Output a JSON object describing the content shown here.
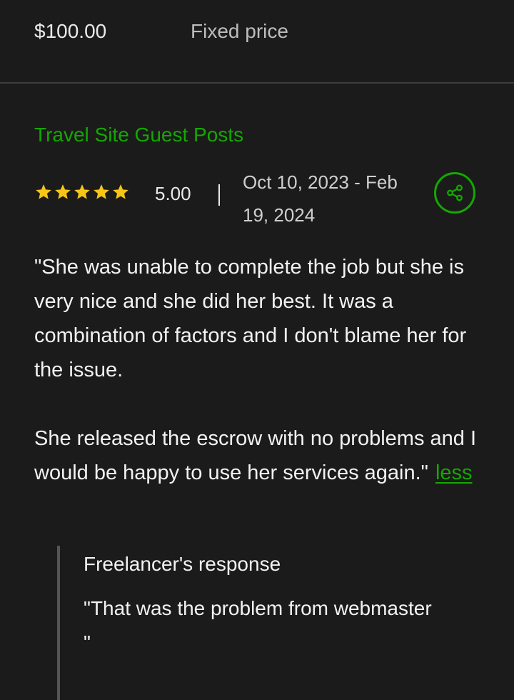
{
  "contract": {
    "price": "$100.00",
    "price_type": "Fixed price"
  },
  "job": {
    "title": "Travel Site Guest Posts"
  },
  "rating": {
    "stars_filled": 5,
    "stars_total": 5,
    "value": "5.00",
    "separator": "|",
    "date_range": "Oct 10, 2023 - Feb 19, 2024"
  },
  "share": {
    "icon": "share-icon"
  },
  "review": {
    "paragraph_1": "\"She was unable to complete the job but she is very nice and she did her best. It was a combination of factors and I don't blame her for the issue.",
    "paragraph_2": "She released the escrow with no problems and I would be happy to use her services again.\"",
    "less_label": "less"
  },
  "freelancer_response": {
    "heading": "Freelancer's response",
    "text": "\"That was the problem from webmaster\n\""
  },
  "colors": {
    "background": "#1b1b1b",
    "accent_green": "#14a800",
    "star_yellow": "#f5c518",
    "text": "#f2f2f2",
    "muted_text": "#bdbdbd",
    "divider": "#3d3d3d"
  }
}
